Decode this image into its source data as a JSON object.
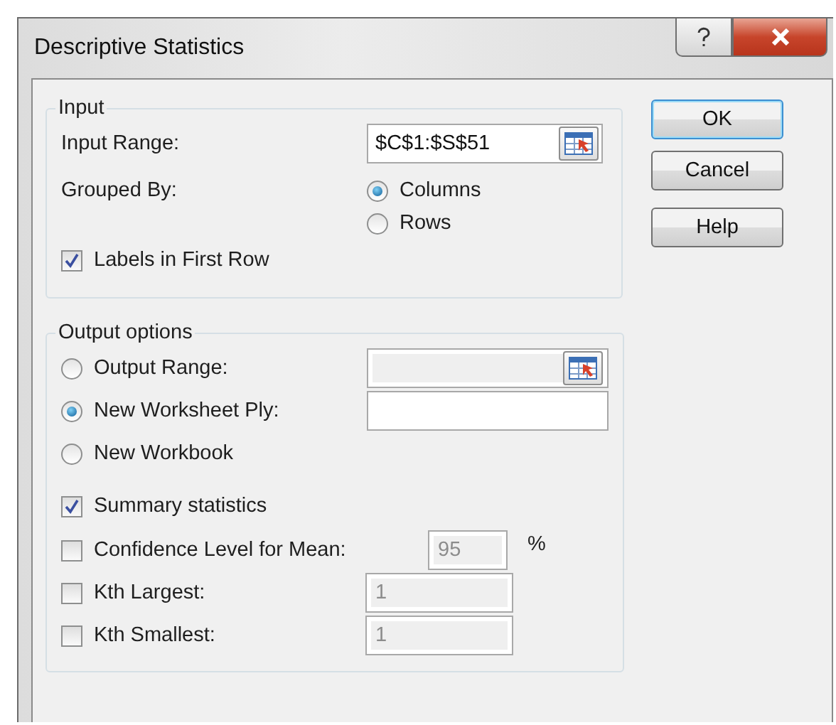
{
  "window": {
    "title": "Descriptive Statistics"
  },
  "input_group": {
    "title": "Input",
    "input_range": {
      "label": "Input Range:",
      "value": "$C$1:$S$51"
    },
    "grouped_by": {
      "label": "Grouped By:",
      "options": [
        {
          "label": "Columns",
          "selected": true
        },
        {
          "label": "Rows",
          "selected": false
        }
      ]
    },
    "labels_in_first_row": {
      "label": "Labels in First Row",
      "checked": true
    }
  },
  "output_group": {
    "title": "Output options",
    "destinations": [
      {
        "label": "Output Range:",
        "selected": false,
        "field": {
          "disabled": true,
          "picker": true
        }
      },
      {
        "label": "New Worksheet Ply:",
        "selected": true,
        "field": {
          "disabled": false,
          "picker": false
        }
      },
      {
        "label": "New Workbook",
        "selected": false
      }
    ],
    "statistics": [
      {
        "label": "Summary statistics",
        "checked": true
      },
      {
        "label": "Confidence Level for Mean:",
        "checked": false,
        "field": {
          "value": "95",
          "disabled": true
        },
        "suffix": "%"
      },
      {
        "label": "Kth Largest:",
        "checked": false,
        "field": {
          "value": "1",
          "disabled": true
        }
      },
      {
        "label": "Kth Smallest:",
        "checked": false,
        "field": {
          "value": "1",
          "disabled": true
        }
      }
    ]
  },
  "buttons": [
    {
      "label": "OK",
      "default": true
    },
    {
      "label": "Cancel",
      "default": false
    },
    {
      "label": "Help",
      "default": false
    }
  ]
}
